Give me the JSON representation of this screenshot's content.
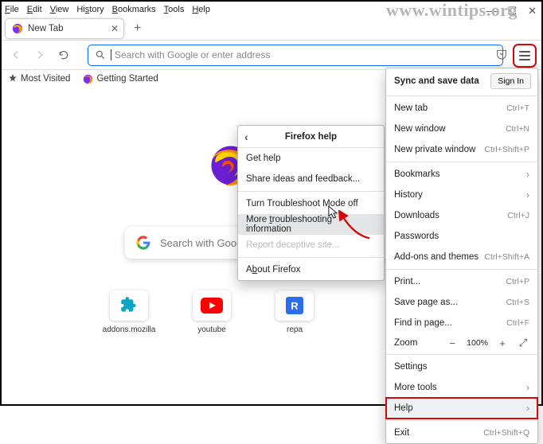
{
  "watermark": "www.wintips.org",
  "menubar": {
    "file": "File",
    "edit": "Edit",
    "view": "View",
    "history": "History",
    "bookmarks": "Bookmarks",
    "tools": "Tools",
    "help": "Help"
  },
  "tab": {
    "title": "New Tab"
  },
  "urlbar": {
    "placeholder": "Search with Google or enter address"
  },
  "bookmarks": {
    "most_visited": "Most Visited",
    "getting_started": "Getting Started"
  },
  "logo_text": "Firefox",
  "search_placeholder": "Search with Google or enter address",
  "shortcuts": [
    {
      "label": "addons.mozilla"
    },
    {
      "label": "youtube"
    },
    {
      "label": "repa"
    }
  ],
  "menu": {
    "sync": "Sync and save data",
    "sign_in": "Sign In",
    "new_tab": {
      "label": "New tab",
      "shortcut": "Ctrl+T"
    },
    "new_window": {
      "label": "New window",
      "shortcut": "Ctrl+N"
    },
    "new_private": {
      "label": "New private window",
      "shortcut": "Ctrl+Shift+P"
    },
    "bookmarks": {
      "label": "Bookmarks"
    },
    "history": {
      "label": "History"
    },
    "downloads": {
      "label": "Downloads",
      "shortcut": "Ctrl+J"
    },
    "passwords": {
      "label": "Passwords"
    },
    "addons": {
      "label": "Add-ons and themes",
      "shortcut": "Ctrl+Shift+A"
    },
    "print": {
      "label": "Print...",
      "shortcut": "Ctrl+P"
    },
    "save": {
      "label": "Save page as...",
      "shortcut": "Ctrl+S"
    },
    "find": {
      "label": "Find in page...",
      "shortcut": "Ctrl+F"
    },
    "zoom": {
      "label": "Zoom",
      "value": "100%"
    },
    "settings": {
      "label": "Settings"
    },
    "more_tools": {
      "label": "More tools"
    },
    "help": {
      "label": "Help"
    },
    "exit": {
      "label": "Exit",
      "shortcut": "Ctrl+Shift+Q"
    }
  },
  "help_panel": {
    "title": "Firefox help",
    "get_help": "Get help",
    "share": "Share ideas and feedback...",
    "ts_mode": "Turn Troubleshoot Mode off",
    "more_ts": "More troubleshooting information",
    "report": "Report deceptive site...",
    "about": "About Firefox"
  }
}
